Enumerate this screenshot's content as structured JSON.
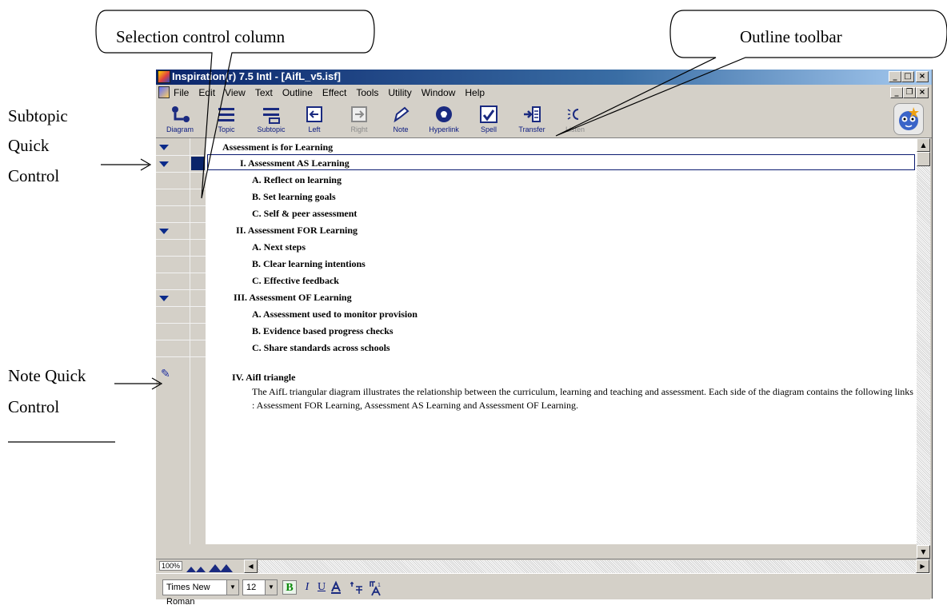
{
  "annotations": {
    "selection_callout": "Selection control column",
    "toolbar_callout": "Outline toolbar",
    "subtopic_label": [
      "Subtopic",
      "Quick",
      "Control"
    ],
    "note_label": [
      "Note Quick",
      "Control"
    ]
  },
  "window": {
    "title": "Inspiration(r) 7.5 Intl - [AifL_v5.isf]",
    "menu": [
      "File",
      "Edit",
      "View",
      "Text",
      "Outline",
      "Effect",
      "Tools",
      "Utility",
      "Window",
      "Help"
    ],
    "toolbar": [
      {
        "label": "Diagram",
        "icon": "diagram-icon"
      },
      {
        "label": "Topic",
        "icon": "topic-icon"
      },
      {
        "label": "Subtopic",
        "icon": "subtopic-icon"
      },
      {
        "label": "Left",
        "icon": "left-arrow-icon"
      },
      {
        "label": "Right",
        "icon": "right-arrow-icon",
        "disabled": true
      },
      {
        "label": "Note",
        "icon": "note-icon"
      },
      {
        "label": "Hyperlink",
        "icon": "hyperlink-icon"
      },
      {
        "label": "Spell",
        "icon": "spell-icon"
      },
      {
        "label": "Transfer",
        "icon": "transfer-icon"
      },
      {
        "label": "Listen",
        "icon": "listen-icon"
      }
    ]
  },
  "outline": {
    "main_idea": "Assessment is for Learning",
    "topics": [
      {
        "num": "I.",
        "title": "Assessment AS Learning",
        "subs": [
          {
            "num": "A.",
            "title": "Reflect on learning"
          },
          {
            "num": "B.",
            "title": "Set learning goals"
          },
          {
            "num": "C.",
            "title": "Self & peer assessment"
          }
        ]
      },
      {
        "num": "II.",
        "title": "Assessment FOR Learning",
        "subs": [
          {
            "num": "A.",
            "title": "Next steps"
          },
          {
            "num": "B.",
            "title": "Clear learning intentions"
          },
          {
            "num": "C.",
            "title": "Effective feedback"
          }
        ]
      },
      {
        "num": "III.",
        "title": "Assessment OF Learning",
        "subs": [
          {
            "num": "A.",
            "title": "Assessment used to monitor provision"
          },
          {
            "num": "B.",
            "title": "Evidence based progress checks"
          },
          {
            "num": "C.",
            "title": "Share standards across schools"
          }
        ]
      },
      {
        "num": "IV.",
        "title": "Aifl triangle",
        "subs": []
      }
    ],
    "note": "The AifL triangular diagram illustrates the relationship between the curriculum, learning and teaching and assessment. Each side of the diagram contains the following links : Assessment FOR Learning, Assessment AS Learning and Assessment OF Learning."
  },
  "zoom": "100%",
  "format": {
    "font": "Times New Roman",
    "size": "12"
  },
  "colors": {
    "titlebar": "#0a246a",
    "selection": "#0a246a",
    "chrome": "#d4d0c8"
  }
}
